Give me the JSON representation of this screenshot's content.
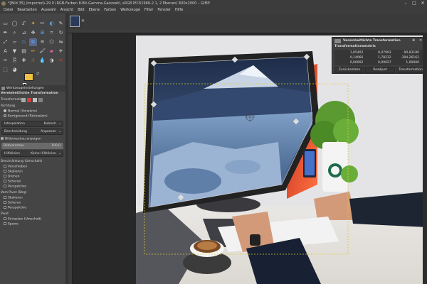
{
  "window": {
    "title": "*[Bild 35] (imported)-29.0 (RGB-Farben 8-Bit-Gamma-Ganzzahl, sRGB IEC61966-2.1, 2 Ebenen) 600x2000 – GIMP",
    "minimize": "–",
    "maximize": "□",
    "close": "✕"
  },
  "menu": [
    "Datei",
    "Bearbeiten",
    "Auswahl",
    "Ansicht",
    "Bild",
    "Ebene",
    "Farben",
    "Werkzeuge",
    "Filter",
    "Fenster",
    "Hilfe"
  ],
  "toolbox": {
    "tools": [
      {
        "icon": "rect-select-icon",
        "glyph": "▭",
        "color": "#d0d0d0"
      },
      {
        "icon": "ellipse-select-icon",
        "glyph": "◯",
        "color": "#d0d0d0"
      },
      {
        "icon": "free-select-icon",
        "glyph": "ᔑ",
        "color": "#d0d0d0"
      },
      {
        "icon": "fuzzy-select-icon",
        "glyph": "✦",
        "color": "#e0c040"
      },
      {
        "icon": "scissors-icon",
        "glyph": "✂",
        "color": "#d0d0d0"
      },
      {
        "icon": "foreground-select-icon",
        "glyph": "◐",
        "color": "#60a0e0"
      },
      {
        "icon": "paths-icon",
        "glyph": "✎",
        "color": "#d0d0d0"
      },
      {
        "icon": "color-picker-icon",
        "glyph": "✒",
        "color": "#d0d0d0"
      },
      {
        "icon": "zoom-icon",
        "glyph": "⌕",
        "color": "#d0d0d0"
      },
      {
        "icon": "measure-icon",
        "glyph": "⊿",
        "color": "#d0d0d0"
      },
      {
        "icon": "move-icon",
        "glyph": "✥",
        "color": "#d0d0d0"
      },
      {
        "icon": "align-icon",
        "glyph": "⊞",
        "color": "#60a0e0"
      },
      {
        "icon": "crop-icon",
        "glyph": "⌗",
        "color": "#d0d0d0"
      },
      {
        "icon": "rotate-icon",
        "glyph": "↻",
        "color": "#d0d0d0"
      },
      {
        "icon": "scale-icon",
        "glyph": "⤢",
        "color": "#d0d0d0"
      },
      {
        "icon": "shear-icon",
        "glyph": "▱",
        "color": "#d0d0d0"
      },
      {
        "icon": "perspective-icon",
        "glyph": "⏢",
        "color": "#60a0e0"
      },
      {
        "icon": "unified-transform-icon",
        "glyph": "⧉",
        "color": "#60a0e0"
      },
      {
        "icon": "warp-transform-icon",
        "glyph": "≋",
        "color": "#d0d0d0"
      },
      {
        "icon": "cage-transform-icon",
        "glyph": "⬠",
        "color": "#d0d0d0"
      },
      {
        "icon": "flip-icon",
        "glyph": "⇋",
        "color": "#d0d0d0"
      },
      {
        "icon": "text-icon",
        "glyph": "A",
        "color": "#d0d0d0"
      },
      {
        "icon": "bucket-fill-icon",
        "glyph": "▼",
        "color": "#d0d0d0"
      },
      {
        "icon": "gradient-icon",
        "glyph": "▤",
        "color": "#d0d0d0"
      },
      {
        "icon": "pencil-icon",
        "glyph": "✏",
        "color": "#e0a040"
      },
      {
        "icon": "paintbrush-icon",
        "glyph": "🖌",
        "color": "#d0d0d0"
      },
      {
        "icon": "eraser-icon",
        "glyph": "▰",
        "color": "#e060a0"
      },
      {
        "icon": "airbrush-icon",
        "glyph": "✈",
        "color": "#d0d0d0"
      },
      {
        "icon": "ink-icon",
        "glyph": "✑",
        "color": "#d0d0d0"
      },
      {
        "icon": "clone-icon",
        "glyph": "⎘",
        "color": "#d0d0d0"
      },
      {
        "icon": "heal-icon",
        "glyph": "✚",
        "color": "#d0d0d0"
      },
      {
        "icon": "smudge-icon",
        "glyph": "☝",
        "color": "#e0c040"
      },
      {
        "icon": "blur-icon",
        "glyph": "💧",
        "color": "#60a0e0"
      },
      {
        "icon": "dodge-burn-icon",
        "glyph": "◑",
        "color": "#d0d0d0"
      },
      {
        "icon": "mypaint-icon",
        "glyph": "✍",
        "color": "#d04040"
      },
      {
        "icon": "paint-select-icon",
        "glyph": "⬚",
        "color": "#d0d0d0"
      },
      {
        "icon": "color-balance-icon",
        "glyph": "◕",
        "color": "#d0d0d0"
      }
    ],
    "active_index": 17
  },
  "tool_options": {
    "tab_label": "Werkzeugeinstellungen",
    "title": "Vereinheitlichte Transformation",
    "transform_label": "Transformation:",
    "direction_label": "Richtung",
    "direction_normal": "Normal (Vorwärts)",
    "direction_corrective": "Korrigierend (Rückwärts)",
    "interpolation_label": "Interpolation",
    "interpolation_value": "Kubisch",
    "clipping_label": "Beschneidung",
    "clipping_value": "Anpassen",
    "show_preview_label": "Bildvorschau anzeigen",
    "opacity_label": "Bildvorschau",
    "opacity_value": "100,0",
    "opacity_fraction": 1.0,
    "guides_label": "Hilfslinien",
    "guides_value": "Keine Hilfslinien",
    "constrain_label": "Beschränkung (Umschalt)",
    "constrain_items": [
      "Verschieben",
      "Skalieren",
      "Drehen",
      "Scheren",
      "Perspektive"
    ],
    "pivot_label": "Vom Pivot (Strg)",
    "pivot_items": [
      "Skalieren",
      "Scheren",
      "Perspektive"
    ],
    "pivot_section_label": "Pivot",
    "pivot_section_items": [
      "Einrasten (Umschalt)",
      "Sperre"
    ]
  },
  "transform_dialog": {
    "title": "Vereinheitlichte Transformation",
    "pin": "⊕",
    "close": "✕",
    "subtitle": "Transformationsmatrix",
    "matrix": [
      [
        "1,05402",
        "0,07993",
        "90,83180"
      ],
      [
        "0,14066",
        "1,78232",
        "-394,26162"
      ],
      [
        "0,00002",
        "0,00027",
        "1,00000"
      ]
    ],
    "buttons": [
      "Zurücksetzen",
      "Readjust",
      "Transformation"
    ]
  },
  "image_tab": {
    "close": "✕"
  }
}
